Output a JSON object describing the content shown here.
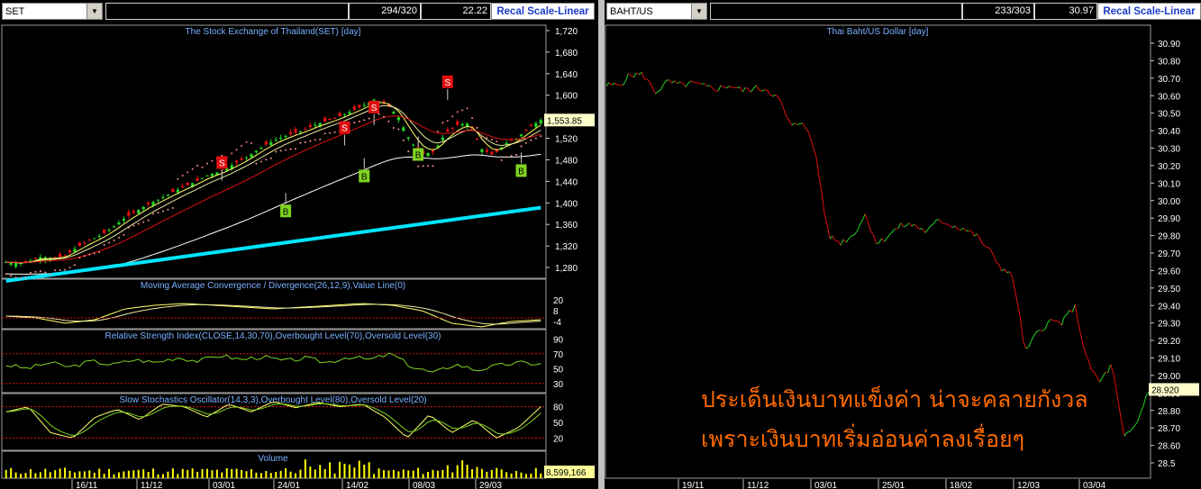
{
  "left": {
    "symbol": "SET",
    "count": "294/320",
    "value": "22.22",
    "recal_label": "Recal Scale-Linear",
    "main_title": "The Stock Exchange of Thailand(SET) [day]",
    "price_ticks": [
      "1,720",
      "1,680",
      "1,640",
      "1,600",
      "1,560",
      "1,520",
      "1,480",
      "1,440",
      "1,400",
      "1,360",
      "1,320",
      "1,280"
    ],
    "last_price": "1,553.85",
    "signal_S": "S",
    "signal_B": "B",
    "macd_title": "Moving Average Convergence / Divergence(26,12,9),Value Line(0)",
    "macd_ticks": [
      "20",
      "8",
      "-4"
    ],
    "rsi_title": "Relative Strength Index(CLOSE,14,30,70),Overbought Level(70),Oversold Level(30)",
    "rsi_ticks": [
      "90",
      "70",
      "50",
      "30"
    ],
    "stoch_title": "Slow Stochastics Oscillator(14,3,3),Overbought Level(80),Oversold Level(20)",
    "stoch_ticks": [
      "80",
      "50",
      "20"
    ],
    "volume_title": "Volume",
    "volume_value": "8,599,166",
    "date_ticks": [
      "16/11",
      "11/12",
      "03/01",
      "24/01",
      "14/02",
      "08/03",
      "29/03"
    ]
  },
  "right": {
    "symbol": "BAHT/US",
    "count": "233/303",
    "value": "30.97",
    "recal_label": "Recal Scale-Linear",
    "main_title": "Thai Baht/US Dollar [day]",
    "price_ticks": [
      "30.90",
      "30.80",
      "30.70",
      "30.60",
      "30.50",
      "30.40",
      "30.30",
      "30.20",
      "30.10",
      "30.00",
      "29.90",
      "29.80",
      "29.70",
      "29.60",
      "29.50",
      "29.40",
      "29.30",
      "29.20",
      "29.10",
      "29.00",
      "28.90",
      "28.80",
      "28.70",
      "28.60",
      "28.5"
    ],
    "last_price": "28.920",
    "date_ticks": [
      "19/11",
      "11/12",
      "03/01",
      "25/01",
      "18/02",
      "12/03",
      "03/04"
    ],
    "annotation_line1": "ประเด็นเงินบาทแข็งค่า น่าจะคลายกังวล",
    "annotation_line2": "เพราะเงินบาทเริ่มอ่อนค่าลงเรื่อยๆ"
  },
  "colors": {
    "up": "#22d422",
    "down": "#e01010",
    "ma_slow": "#ffffff",
    "ma_long": "#00e5ff",
    "signal_s_bg": "#e01010",
    "signal_b_bg": "#7ed321",
    "recal_text": "#1e3cc8"
  },
  "chart_data": [
    {
      "type": "line",
      "title": "The Stock Exchange of Thailand(SET) [day]",
      "series": [
        {
          "name": "SET",
          "values": [
            1290,
            1287,
            1292,
            1300,
            1296,
            1302,
            1318,
            1330,
            1340,
            1355,
            1372,
            1385,
            1398,
            1408,
            1420,
            1430,
            1440,
            1452,
            1458,
            1470,
            1482,
            1496,
            1510,
            1520,
            1528,
            1535,
            1545,
            1552,
            1560,
            1570,
            1580,
            1592,
            1584,
            1560,
            1515,
            1490,
            1495,
            1530,
            1545,
            1548,
            1500,
            1488,
            1510,
            1520,
            1540,
            1553.85
          ]
        }
      ],
      "ylim": [
        1260,
        1730
      ]
    },
    {
      "type": "line",
      "title": "Thai Baht/US Dollar [day]",
      "series": [
        {
          "name": "BAHT/US",
          "values": [
            30.66,
            30.66,
            30.72,
            30.72,
            30.62,
            30.68,
            30.66,
            30.67,
            30.65,
            30.64,
            30.66,
            30.63,
            30.64,
            30.64,
            30.58,
            30.42,
            30.46,
            30.26,
            29.8,
            29.76,
            29.8,
            29.92,
            29.75,
            29.81,
            29.86,
            29.86,
            29.82,
            29.89,
            29.86,
            29.84,
            29.8,
            29.72,
            29.62,
            29.56,
            29.13,
            29.25,
            29.31,
            29.3,
            29.4,
            29.08,
            28.96,
            29.06,
            28.64,
            28.72,
            28.92
          ]
        }
      ],
      "ylim": [
        28.5,
        30.95
      ]
    }
  ]
}
